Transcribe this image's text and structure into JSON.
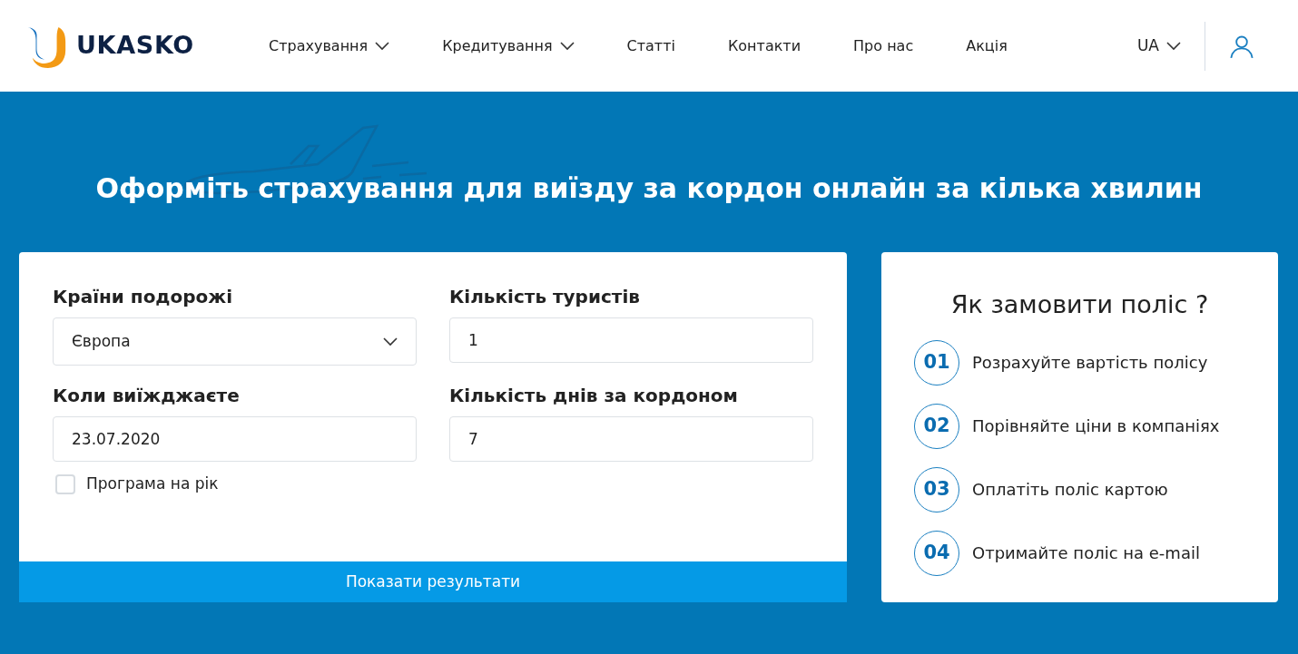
{
  "header": {
    "logo": "UKASKO",
    "nav": [
      {
        "label": "Страхування",
        "has_menu": true
      },
      {
        "label": "Кредитування",
        "has_menu": true
      },
      {
        "label": "Статті",
        "has_menu": false
      },
      {
        "label": "Контакти",
        "has_menu": false
      },
      {
        "label": "Про нас",
        "has_menu": false
      },
      {
        "label": "Акція",
        "has_menu": false
      }
    ],
    "language": "UA"
  },
  "hero": {
    "title": "Оформіть страхування для виїзду за кордон онлайн за кілька хвилин"
  },
  "form": {
    "fields": [
      {
        "kind": "select",
        "label": "Країни подорожі",
        "value": "Європа"
      },
      {
        "kind": "input",
        "label": "Кількість туристів",
        "value": "1"
      },
      {
        "kind": "input",
        "label": "Коли виїжджаєте",
        "value": "23.07.2020"
      },
      {
        "kind": "input",
        "label": "Кількість днів за кордоном",
        "value": "7"
      }
    ],
    "checkbox": {
      "label": "Програма на рік",
      "checked": false
    },
    "submit": "Показати результати"
  },
  "steps": {
    "title": "Як замовити поліс ?",
    "items": [
      {
        "number": "01",
        "text": "Розрахуйте вартість полісу"
      },
      {
        "number": "02",
        "text": "Порівняйте ціни в компаніях"
      },
      {
        "number": "03",
        "text": "Оплатіть поліс картою"
      },
      {
        "number": "04",
        "text": "Отримайте поліс на e-mail"
      }
    ]
  }
}
